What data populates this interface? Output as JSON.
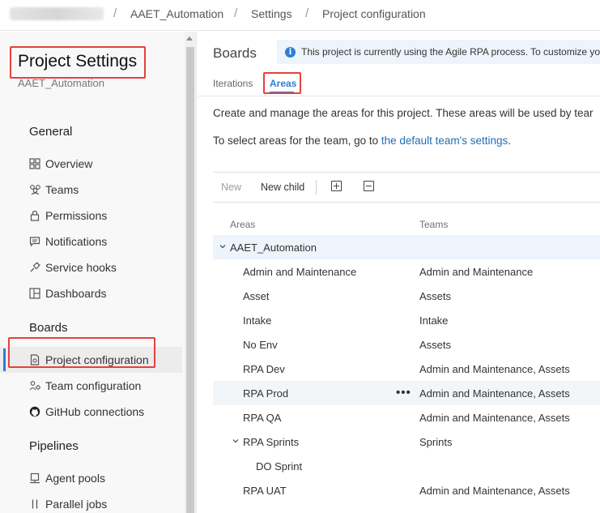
{
  "breadcrumb": {
    "org_redacted": "",
    "items": [
      "AAET_Automation",
      "Settings",
      "Project configuration"
    ],
    "separator": "/"
  },
  "sidebar": {
    "title": "Project Settings",
    "project": "AAET_Automation",
    "sections": [
      {
        "heading": "General",
        "items": [
          {
            "label": "Overview",
            "icon": "overview-icon"
          },
          {
            "label": "Teams",
            "icon": "teams-icon"
          },
          {
            "label": "Permissions",
            "icon": "lock-icon"
          },
          {
            "label": "Notifications",
            "icon": "notification-icon"
          },
          {
            "label": "Service hooks",
            "icon": "service-hooks-icon"
          },
          {
            "label": "Dashboards",
            "icon": "dashboard-icon"
          }
        ]
      },
      {
        "heading": "Boards",
        "items": [
          {
            "label": "Project configuration",
            "icon": "project-config-icon",
            "active": true
          },
          {
            "label": "Team configuration",
            "icon": "team-config-icon"
          },
          {
            "label": "GitHub connections",
            "icon": "github-icon"
          }
        ]
      },
      {
        "heading": "Pipelines",
        "items": [
          {
            "label": "Agent pools",
            "icon": "agent-pools-icon"
          },
          {
            "label": "Parallel jobs",
            "icon": "parallel-jobs-icon"
          }
        ]
      }
    ]
  },
  "main": {
    "heading": "Boards",
    "banner": "This project is currently using the Agile RPA process. To customize you",
    "tabs": [
      {
        "label": "Iterations",
        "active": false
      },
      {
        "label": "Areas",
        "active": true
      }
    ],
    "description": "Create and manage the areas for this project. These areas will be used by tear",
    "team_line_prefix": "To select areas for the team, go to ",
    "team_line_link": "the default team's settings",
    "team_line_suffix": ".",
    "toolbar": {
      "new_label": "New",
      "new_child_label": "New child",
      "expand_icon": "expand-all-icon",
      "collapse_icon": "collapse-all-icon"
    },
    "columns": {
      "areas": "Areas",
      "teams": "Teams"
    },
    "rows": [
      {
        "area": "AAET_Automation",
        "teams": "",
        "level": 0,
        "expandable": true
      },
      {
        "area": "Admin and Maintenance",
        "teams": "Admin and Maintenance",
        "level": 1
      },
      {
        "area": "Asset",
        "teams": "Assets",
        "level": 1
      },
      {
        "area": "Intake",
        "teams": "Intake",
        "level": 1
      },
      {
        "area": "No Env",
        "teams": "Assets",
        "level": 1
      },
      {
        "area": "RPA Dev",
        "teams": "Admin and Maintenance, Assets",
        "level": 1
      },
      {
        "area": "RPA Prod",
        "teams": "Admin and Maintenance, Assets",
        "level": 1,
        "more": "•••"
      },
      {
        "area": "RPA QA",
        "teams": "Admin and Maintenance, Assets",
        "level": 1
      },
      {
        "area": "RPA Sprints",
        "teams": "Sprints",
        "level": 1,
        "expandable": true
      },
      {
        "area": "DO Sprint",
        "teams": "",
        "level": 2
      },
      {
        "area": "RPA UAT",
        "teams": "Admin and Maintenance, Assets",
        "level": 1
      }
    ]
  },
  "colors": {
    "accent": "#2d7ed6",
    "highlight_box": "#e5413d",
    "link": "#1f6fb5",
    "selected_row": "#edf4fb"
  }
}
